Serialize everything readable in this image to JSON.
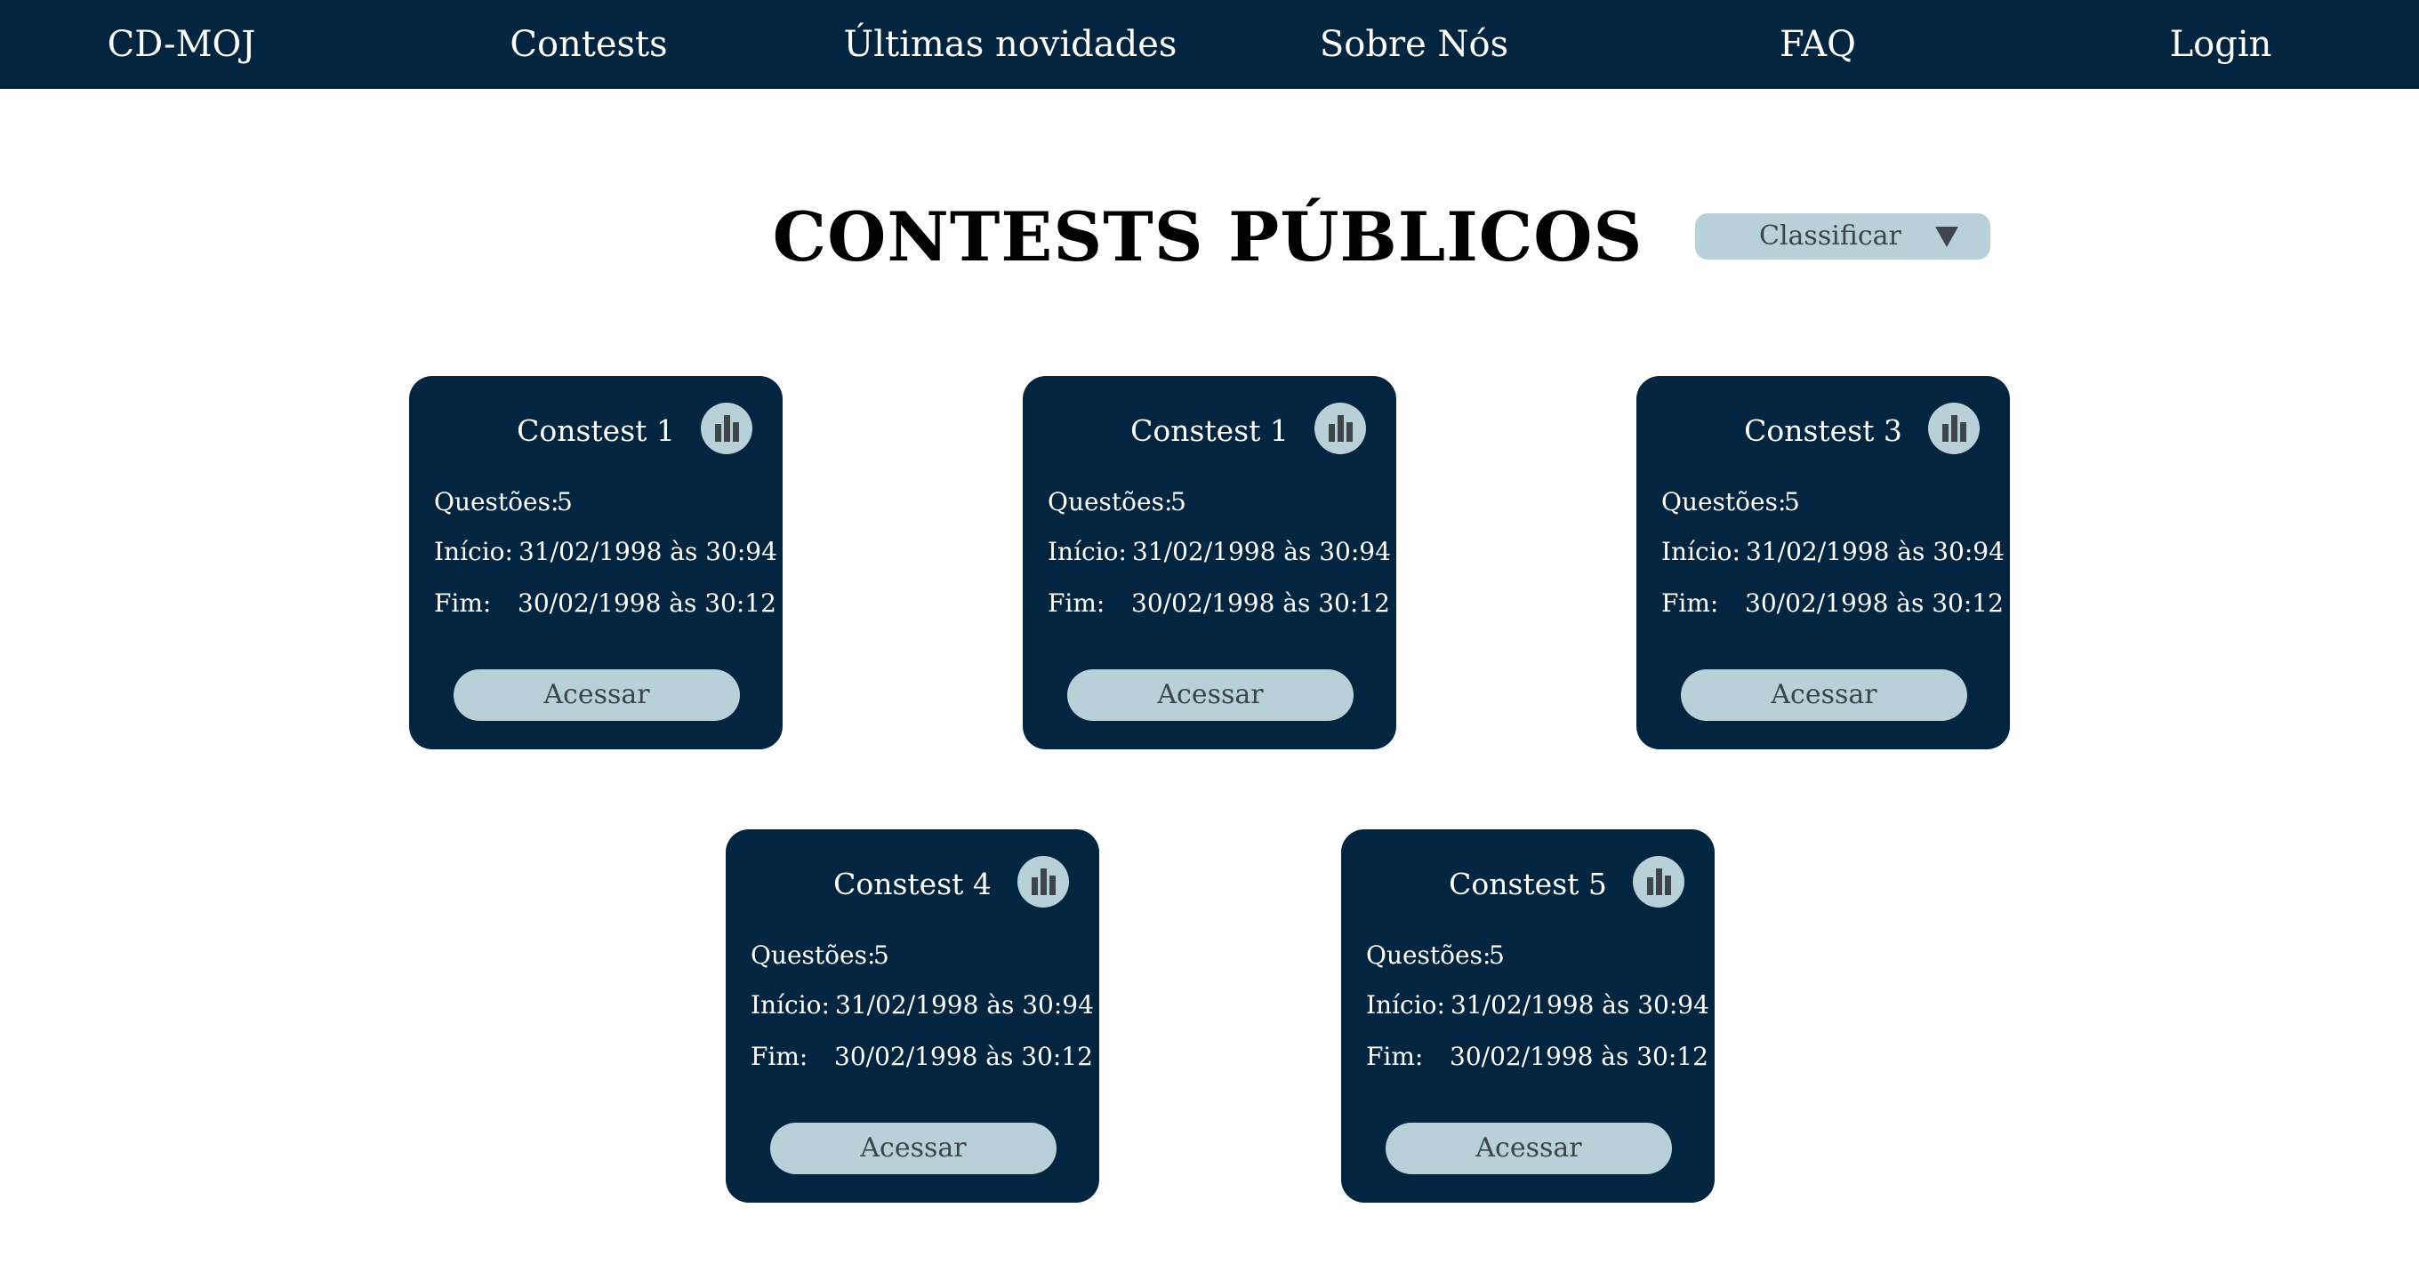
{
  "nav": {
    "brand": "CD-MOJ",
    "items": [
      {
        "label": "Contests"
      },
      {
        "label": "Últimas novidades"
      },
      {
        "label": "Sobre Nós"
      },
      {
        "label": "FAQ"
      },
      {
        "label": "Login"
      }
    ]
  },
  "heading": {
    "title": "CONTESTS PÚBLICOS",
    "sort_label": "Classificar",
    "sort_icon": "triangle-down-icon"
  },
  "colors": {
    "nav_bg": "#032540",
    "card_bg": "#032540",
    "accent": "#b8d1d8",
    "button_text": "#3c4548",
    "icon_fill": "#3d4649"
  },
  "cards": [
    {
      "title": "Constest 1",
      "questions_label": "Questões:",
      "questions": "5",
      "start_label": "Início:",
      "start": "31/02/1998 às 30:94",
      "end_label": "Fim:",
      "end": "30/02/1998 às 30:12",
      "button": "Acessar",
      "icon": "bar-chart-icon"
    },
    {
      "title": "Constest 1",
      "questions_label": "Questões:",
      "questions": "5",
      "start_label": "Início:",
      "start": "31/02/1998 às 30:94",
      "end_label": "Fim:",
      "end": "30/02/1998 às 30:12",
      "button": "Acessar",
      "icon": "bar-chart-icon"
    },
    {
      "title": "Constest 3",
      "questions_label": "Questões:",
      "questions": "5",
      "start_label": "Início:",
      "start": "31/02/1998 às 30:94",
      "end_label": "Fim:",
      "end": "30/02/1998 às 30:12",
      "button": "Acessar",
      "icon": "bar-chart-icon"
    },
    {
      "title": "Constest 4",
      "questions_label": "Questões:",
      "questions": "5",
      "start_label": "Início:",
      "start": "31/02/1998 às 30:94",
      "end_label": "Fim:",
      "end": "30/02/1998 às 30:12",
      "button": "Acessar",
      "icon": "bar-chart-icon"
    },
    {
      "title": "Constest 5",
      "questions_label": "Questões:",
      "questions": "5",
      "start_label": "Início:",
      "start": "31/02/1998 às 30:94",
      "end_label": "Fim:",
      "end": "30/02/1998 às 30:12",
      "button": "Acessar",
      "icon": "bar-chart-icon"
    }
  ]
}
